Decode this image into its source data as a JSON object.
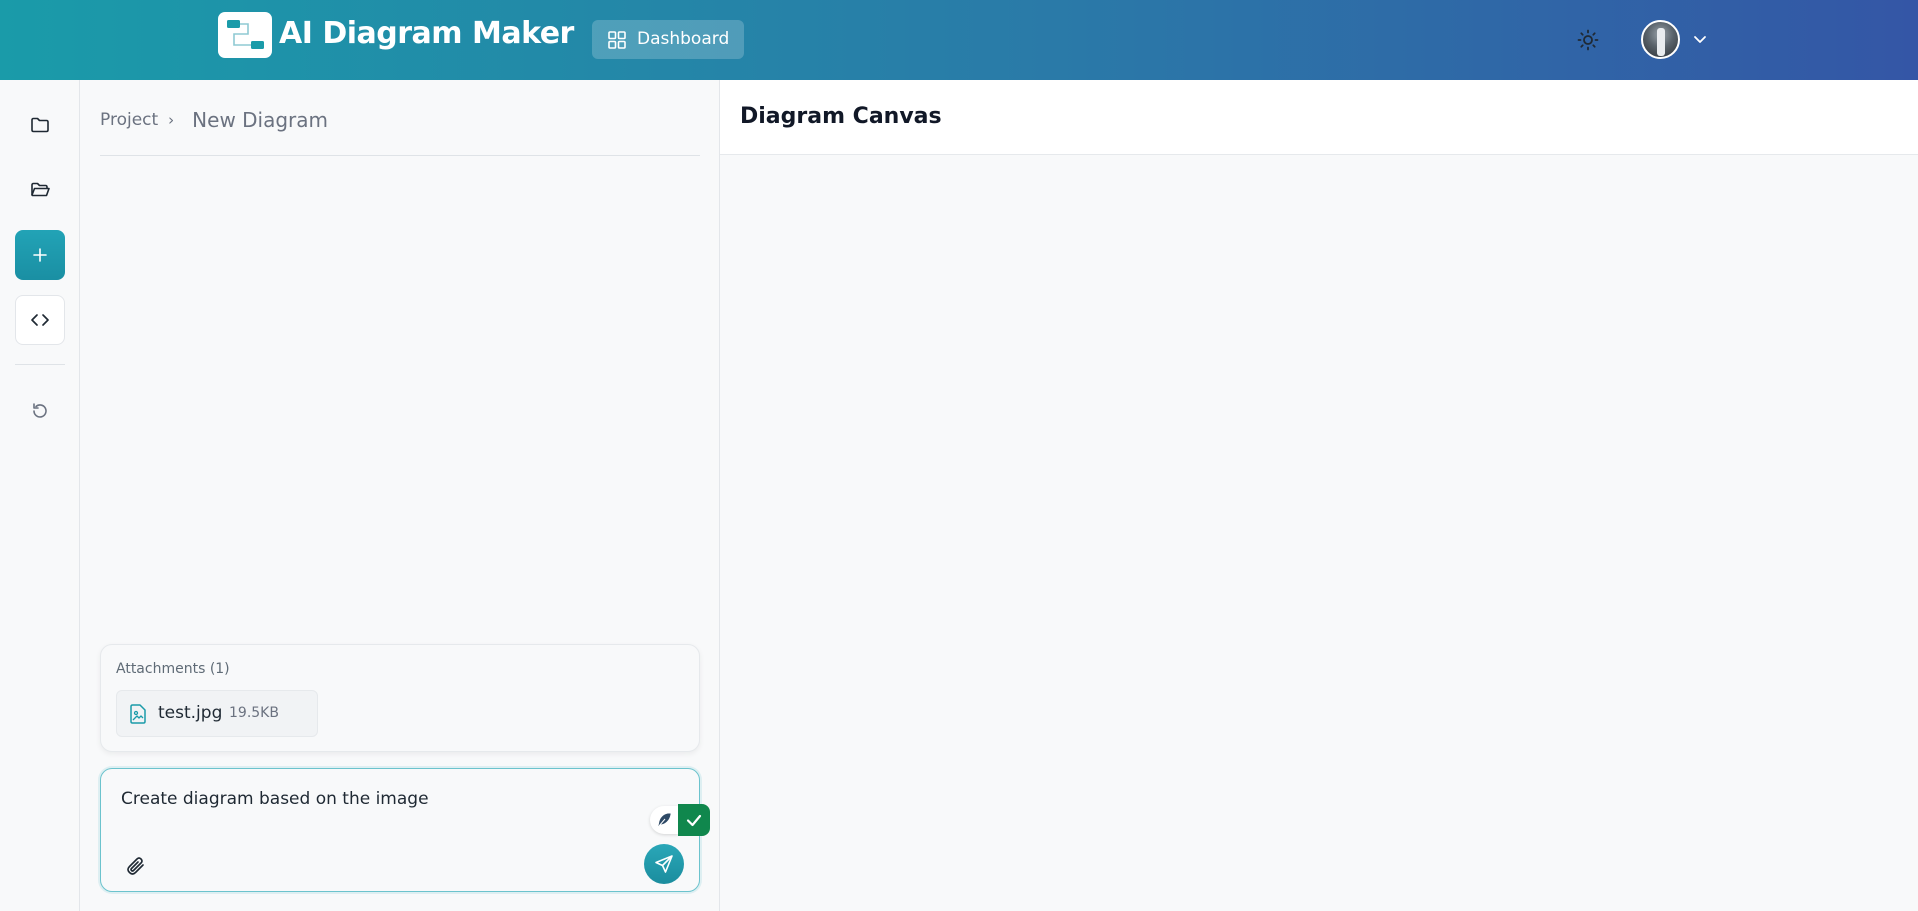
{
  "header": {
    "app_title": "AI Diagram Maker",
    "dashboard_label": "Dashboard",
    "theme_icon": "sun-icon",
    "account_chevron_icon": "chevron-down-icon"
  },
  "sidebar": {
    "items": [
      {
        "icon": "folder-icon"
      },
      {
        "icon": "folder-open-icon"
      },
      {
        "icon": "plus-icon"
      },
      {
        "icon": "code-icon"
      },
      {
        "icon": "history-icon"
      }
    ]
  },
  "chat": {
    "breadcrumb": {
      "project": "Project",
      "separator": "›",
      "current": "New Diagram"
    },
    "attachments": {
      "title": "Attachments (1)",
      "files": [
        {
          "name": "test.jpg",
          "size": "19.5KB",
          "icon": "image-file-icon"
        }
      ]
    },
    "composer": {
      "value": "Create diagram based on the image",
      "attach_icon": "paperclip-icon",
      "send_icon": "send-icon"
    }
  },
  "canvas": {
    "title": "Diagram Canvas"
  },
  "colors": {
    "header_gradient_start": "#1a9ba9",
    "header_gradient_end": "#3456a6",
    "accent": "#1a8fa3",
    "check_green": "#10874d"
  }
}
